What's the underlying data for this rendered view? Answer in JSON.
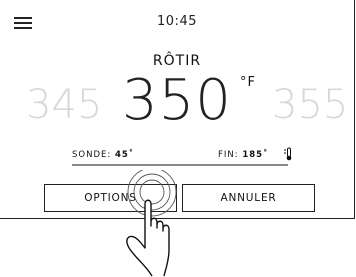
{
  "header": {
    "time": "10:45",
    "menu_icon": "hamburger-menu-icon"
  },
  "mode": {
    "label": "RÔTIR"
  },
  "temperature": {
    "previous": "345",
    "current": "350",
    "next": "355",
    "unit": "°F"
  },
  "probe": {
    "label": "SONDE:",
    "value": "45˚"
  },
  "end": {
    "label": "FIN:",
    "value": "185˚",
    "icon": "thermometer-icon"
  },
  "buttons": {
    "options": "OPTIONS",
    "cancel": "ANNULER"
  },
  "overlay": {
    "icon": "pointing-hand-tap-icon"
  }
}
